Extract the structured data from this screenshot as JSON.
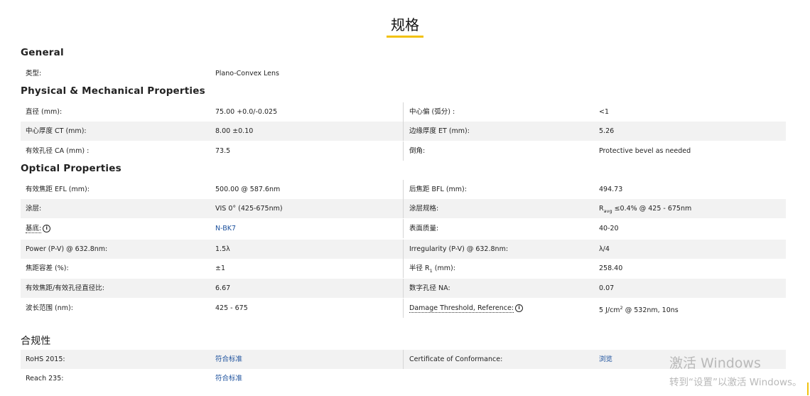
{
  "page": {
    "title": "规格"
  },
  "sections": {
    "general": {
      "heading": "General"
    },
    "physical": {
      "heading": "Physical & Mechanical Properties"
    },
    "optical": {
      "heading": "Optical Properties"
    },
    "compliance": {
      "heading": "合规性"
    }
  },
  "rows": {
    "type": {
      "label": "类型:",
      "value": "Plano-Convex Lens"
    },
    "diameter": {
      "label": "直径 (mm):",
      "value": "75.00 +0.0/-0.025"
    },
    "centering": {
      "label": "中心偏 (弧分) :",
      "value": "<1"
    },
    "ct": {
      "label": "中心厚度 CT (mm):",
      "value": "8.00 ±0.10"
    },
    "et": {
      "label": "边缘厚度 ET (mm):",
      "value": "5.26"
    },
    "ca": {
      "label": "有效孔径 CA (mm) :",
      "value": "73.5"
    },
    "bevel": {
      "label": "倒角:",
      "value": "Protective bevel as needed"
    },
    "efl": {
      "label": "有效焦距 EFL (mm):",
      "value": "500.00 @ 587.6nm"
    },
    "bfl": {
      "label": "后焦距 BFL (mm):",
      "value": "494.73"
    },
    "coating": {
      "label": "涂层:",
      "value": "VIS 0° (425-675nm)"
    },
    "coating_spec": {
      "label": "涂层规格:",
      "value_prefix": "R",
      "value_sub": "avg",
      "value_rest": " ≤0.4% @ 425 - 675nm"
    },
    "substrate": {
      "label": "基底:",
      "value": "N-BK7"
    },
    "surface_quality": {
      "label": "表面质量:",
      "value": "40-20"
    },
    "power": {
      "label": "Power (P-V) @ 632.8nm:",
      "value": "1.5λ"
    },
    "irregularity": {
      "label": "Irregularity (P-V) @ 632.8nm:",
      "value": "λ/4"
    },
    "focal_tol": {
      "label": "焦距容差 (%):",
      "value": "±1"
    },
    "radius": {
      "label_prefix": "半径 R",
      "label_sub": "1",
      "label_rest": " (mm):",
      "value": "258.40"
    },
    "fnum": {
      "label": "有效焦距/有效孔径直径比:",
      "value": "6.67"
    },
    "na": {
      "label": "数字孔径 NA:",
      "value": "0.07"
    },
    "wavelength": {
      "label": "波长范围 (nm):",
      "value": "425 - 675"
    },
    "damage": {
      "label": "Damage Threshold, Reference:",
      "value_prefix": "5 J/cm",
      "value_sup": "2",
      "value_rest": " @ 532nm, 10ns"
    },
    "rohs": {
      "label": "RoHS 2015:",
      "value": "符合标准"
    },
    "coc": {
      "label": "Certificate of Conformance:",
      "value": "浏览"
    },
    "reach": {
      "label": "Reach 235:",
      "value": "符合标准"
    }
  },
  "info_glyph": "i",
  "watermark": {
    "line1": "激活 Windows",
    "line2": "转到“设置”以激活 Windows。"
  },
  "colors": {
    "accent": "#f2c20f",
    "link": "#1a4f9c",
    "row_shade": "#f2f2f2"
  }
}
